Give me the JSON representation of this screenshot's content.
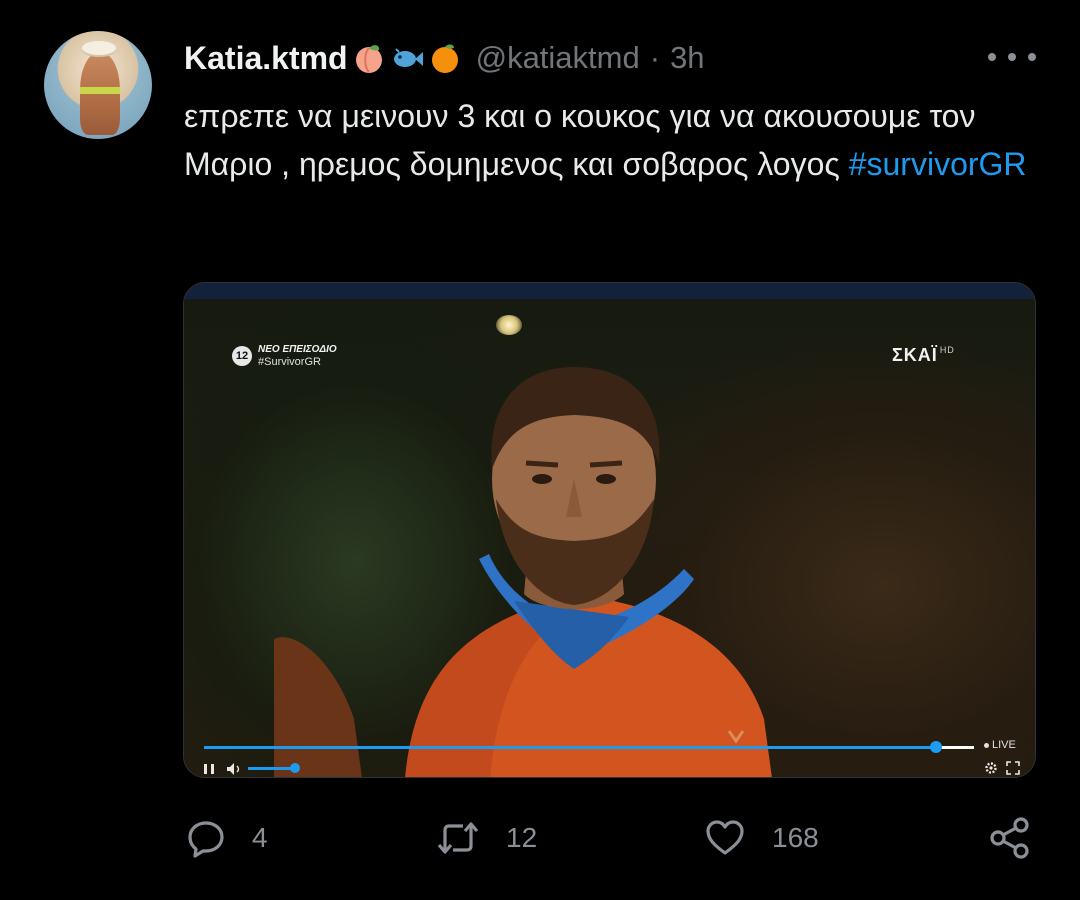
{
  "author": {
    "display_name": "Katia.ktmd",
    "name_emojis": [
      "peach-emoji",
      "fish-emoji",
      "tangerine-emoji"
    ],
    "handle": "@katiaktmd",
    "separator": "·",
    "time": "3h",
    "avatar": "avatar-photo"
  },
  "tweet": {
    "text": "επρεπε να μεινουν 3 και ο κουκος για να ακουσουμε τον Μαριο , ηρεμος δομημενος και σοβαρος λογος",
    "hashtag": "#survivorGR"
  },
  "video": {
    "episode_badge": "12",
    "episode_title": "ΝΕΟ ΕΠΕΙΣΟΔΙΟ",
    "episode_tag": "#SurvivorGR",
    "channel_logo": "ΣΚΑΪ",
    "channel_hd": "HD",
    "live_label": "LIVE",
    "progress_fraction": 0.95,
    "volume_fraction": 1.0
  },
  "actions": {
    "replies": "4",
    "retweets": "12",
    "likes": "168"
  },
  "icons": {
    "more": "more-horizontal-icon",
    "reply": "reply-icon",
    "retweet": "retweet-icon",
    "like": "heart-icon",
    "share": "share-icon"
  },
  "colors": {
    "background": "#000000",
    "text": "#e7e9ea",
    "muted": "#71767b",
    "accent": "#1d9bf0"
  }
}
